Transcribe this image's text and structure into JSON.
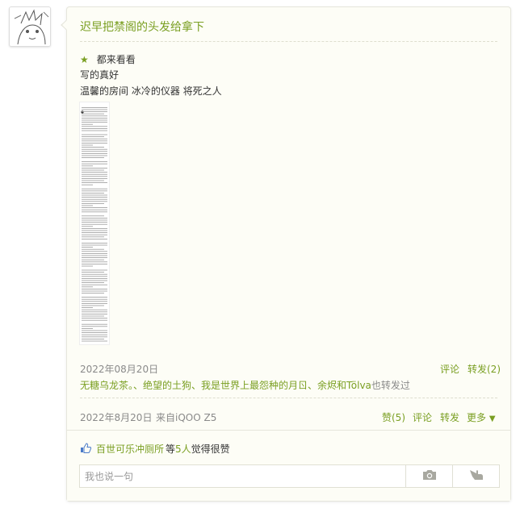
{
  "post": {
    "title": "迟早把禁阁的头发给拿下",
    "line1": "都来看看",
    "line2": "写的真好",
    "line3": "温馨的房间 冰冷的仪器 将死之人"
  },
  "meta1": {
    "date": "2022年08月20日",
    "comment": "评论",
    "repost": "转发(2)"
  },
  "reposters": {
    "names": "无糖乌龙茶。、绝望的土狗、我是世界上最怨种的月ㄖ、余烬和Tölva",
    "suffix": "也转发过"
  },
  "meta2": {
    "date": "2022年8月20日",
    "source": "来自iQOO Z5",
    "like": "赞(5)",
    "comment": "评论",
    "repost": "转发",
    "more": "更多"
  },
  "likes": {
    "name": "百世可乐冲厕所",
    "mid": "等",
    "count": "5人",
    "suffix": "觉得很赞"
  },
  "comment_box": {
    "placeholder": "我也说一句"
  },
  "colors": {
    "accent": "#7a9f22",
    "card_bg": "#fdfdf6",
    "muted": "#8a8a8a"
  }
}
